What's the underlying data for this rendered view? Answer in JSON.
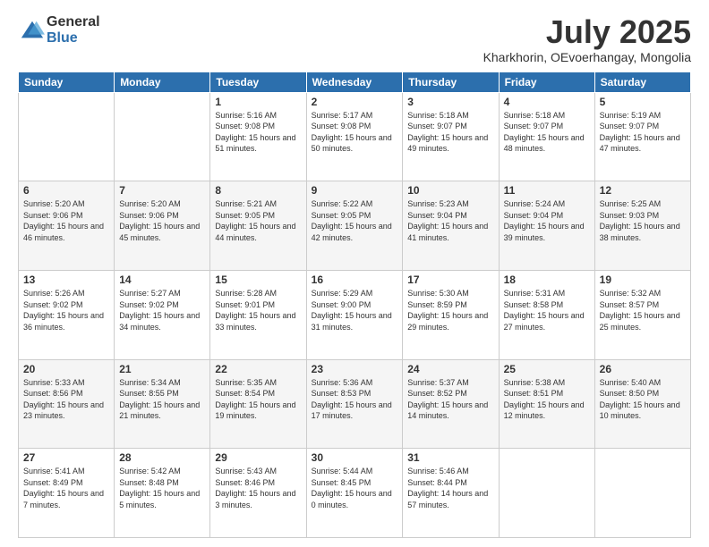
{
  "logo": {
    "general": "General",
    "blue": "Blue"
  },
  "title": "July 2025",
  "subtitle": "Kharkhorin, OEvoerhangay, Mongolia",
  "days_of_week": [
    "Sunday",
    "Monday",
    "Tuesday",
    "Wednesday",
    "Thursday",
    "Friday",
    "Saturday"
  ],
  "weeks": [
    [
      {
        "day": "",
        "sunrise": "",
        "sunset": "",
        "daylight": ""
      },
      {
        "day": "",
        "sunrise": "",
        "sunset": "",
        "daylight": ""
      },
      {
        "day": "1",
        "sunrise": "Sunrise: 5:16 AM",
        "sunset": "Sunset: 9:08 PM",
        "daylight": "Daylight: 15 hours and 51 minutes."
      },
      {
        "day": "2",
        "sunrise": "Sunrise: 5:17 AM",
        "sunset": "Sunset: 9:08 PM",
        "daylight": "Daylight: 15 hours and 50 minutes."
      },
      {
        "day": "3",
        "sunrise": "Sunrise: 5:18 AM",
        "sunset": "Sunset: 9:07 PM",
        "daylight": "Daylight: 15 hours and 49 minutes."
      },
      {
        "day": "4",
        "sunrise": "Sunrise: 5:18 AM",
        "sunset": "Sunset: 9:07 PM",
        "daylight": "Daylight: 15 hours and 48 minutes."
      },
      {
        "day": "5",
        "sunrise": "Sunrise: 5:19 AM",
        "sunset": "Sunset: 9:07 PM",
        "daylight": "Daylight: 15 hours and 47 minutes."
      }
    ],
    [
      {
        "day": "6",
        "sunrise": "Sunrise: 5:20 AM",
        "sunset": "Sunset: 9:06 PM",
        "daylight": "Daylight: 15 hours and 46 minutes."
      },
      {
        "day": "7",
        "sunrise": "Sunrise: 5:20 AM",
        "sunset": "Sunset: 9:06 PM",
        "daylight": "Daylight: 15 hours and 45 minutes."
      },
      {
        "day": "8",
        "sunrise": "Sunrise: 5:21 AM",
        "sunset": "Sunset: 9:05 PM",
        "daylight": "Daylight: 15 hours and 44 minutes."
      },
      {
        "day": "9",
        "sunrise": "Sunrise: 5:22 AM",
        "sunset": "Sunset: 9:05 PM",
        "daylight": "Daylight: 15 hours and 42 minutes."
      },
      {
        "day": "10",
        "sunrise": "Sunrise: 5:23 AM",
        "sunset": "Sunset: 9:04 PM",
        "daylight": "Daylight: 15 hours and 41 minutes."
      },
      {
        "day": "11",
        "sunrise": "Sunrise: 5:24 AM",
        "sunset": "Sunset: 9:04 PM",
        "daylight": "Daylight: 15 hours and 39 minutes."
      },
      {
        "day": "12",
        "sunrise": "Sunrise: 5:25 AM",
        "sunset": "Sunset: 9:03 PM",
        "daylight": "Daylight: 15 hours and 38 minutes."
      }
    ],
    [
      {
        "day": "13",
        "sunrise": "Sunrise: 5:26 AM",
        "sunset": "Sunset: 9:02 PM",
        "daylight": "Daylight: 15 hours and 36 minutes."
      },
      {
        "day": "14",
        "sunrise": "Sunrise: 5:27 AM",
        "sunset": "Sunset: 9:02 PM",
        "daylight": "Daylight: 15 hours and 34 minutes."
      },
      {
        "day": "15",
        "sunrise": "Sunrise: 5:28 AM",
        "sunset": "Sunset: 9:01 PM",
        "daylight": "Daylight: 15 hours and 33 minutes."
      },
      {
        "day": "16",
        "sunrise": "Sunrise: 5:29 AM",
        "sunset": "Sunset: 9:00 PM",
        "daylight": "Daylight: 15 hours and 31 minutes."
      },
      {
        "day": "17",
        "sunrise": "Sunrise: 5:30 AM",
        "sunset": "Sunset: 8:59 PM",
        "daylight": "Daylight: 15 hours and 29 minutes."
      },
      {
        "day": "18",
        "sunrise": "Sunrise: 5:31 AM",
        "sunset": "Sunset: 8:58 PM",
        "daylight": "Daylight: 15 hours and 27 minutes."
      },
      {
        "day": "19",
        "sunrise": "Sunrise: 5:32 AM",
        "sunset": "Sunset: 8:57 PM",
        "daylight": "Daylight: 15 hours and 25 minutes."
      }
    ],
    [
      {
        "day": "20",
        "sunrise": "Sunrise: 5:33 AM",
        "sunset": "Sunset: 8:56 PM",
        "daylight": "Daylight: 15 hours and 23 minutes."
      },
      {
        "day": "21",
        "sunrise": "Sunrise: 5:34 AM",
        "sunset": "Sunset: 8:55 PM",
        "daylight": "Daylight: 15 hours and 21 minutes."
      },
      {
        "day": "22",
        "sunrise": "Sunrise: 5:35 AM",
        "sunset": "Sunset: 8:54 PM",
        "daylight": "Daylight: 15 hours and 19 minutes."
      },
      {
        "day": "23",
        "sunrise": "Sunrise: 5:36 AM",
        "sunset": "Sunset: 8:53 PM",
        "daylight": "Daylight: 15 hours and 17 minutes."
      },
      {
        "day": "24",
        "sunrise": "Sunrise: 5:37 AM",
        "sunset": "Sunset: 8:52 PM",
        "daylight": "Daylight: 15 hours and 14 minutes."
      },
      {
        "day": "25",
        "sunrise": "Sunrise: 5:38 AM",
        "sunset": "Sunset: 8:51 PM",
        "daylight": "Daylight: 15 hours and 12 minutes."
      },
      {
        "day": "26",
        "sunrise": "Sunrise: 5:40 AM",
        "sunset": "Sunset: 8:50 PM",
        "daylight": "Daylight: 15 hours and 10 minutes."
      }
    ],
    [
      {
        "day": "27",
        "sunrise": "Sunrise: 5:41 AM",
        "sunset": "Sunset: 8:49 PM",
        "daylight": "Daylight: 15 hours and 7 minutes."
      },
      {
        "day": "28",
        "sunrise": "Sunrise: 5:42 AM",
        "sunset": "Sunset: 8:48 PM",
        "daylight": "Daylight: 15 hours and 5 minutes."
      },
      {
        "day": "29",
        "sunrise": "Sunrise: 5:43 AM",
        "sunset": "Sunset: 8:46 PM",
        "daylight": "Daylight: 15 hours and 3 minutes."
      },
      {
        "day": "30",
        "sunrise": "Sunrise: 5:44 AM",
        "sunset": "Sunset: 8:45 PM",
        "daylight": "Daylight: 15 hours and 0 minutes."
      },
      {
        "day": "31",
        "sunrise": "Sunrise: 5:46 AM",
        "sunset": "Sunset: 8:44 PM",
        "daylight": "Daylight: 14 hours and 57 minutes."
      },
      {
        "day": "",
        "sunrise": "",
        "sunset": "",
        "daylight": ""
      },
      {
        "day": "",
        "sunrise": "",
        "sunset": "",
        "daylight": ""
      }
    ]
  ]
}
